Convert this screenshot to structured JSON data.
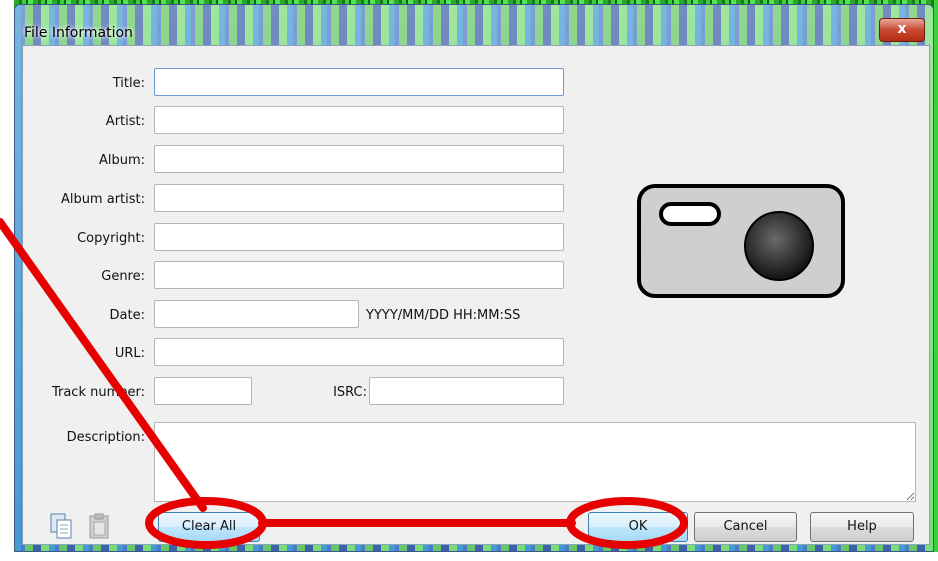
{
  "window": {
    "title": "File Information",
    "close_glyph": "x"
  },
  "form": {
    "title_label": "Title:",
    "title_value": "",
    "artist_label": "Artist:",
    "artist_value": "",
    "album_label": "Album:",
    "album_value": "",
    "album_artist_label": "Album artist:",
    "album_artist_value": "",
    "copyright_label": "Copyright:",
    "copyright_value": "",
    "genre_label": "Genre:",
    "genre_value": "",
    "date_label": "Date:",
    "date_value": "",
    "date_format_hint": "YYYY/MM/DD HH:MM:SS",
    "url_label": "URL:",
    "url_value": "",
    "track_number_label": "Track number:",
    "track_number_value": "",
    "isrc_label": "ISRC:",
    "isrc_value": "",
    "description_label": "Description:",
    "description_value": ""
  },
  "cover_art": {
    "icon": "camera-icon"
  },
  "toolbar": {
    "copy_icon": "copy-icon",
    "paste_icon": "paste-icon",
    "clear_all_label": "Clear All",
    "ok_label": "OK",
    "cancel_label": "Cancel",
    "help_label": "Help"
  },
  "annotation": {
    "color": "#e60000",
    "highlighted": [
      "Clear All",
      "OK"
    ]
  }
}
